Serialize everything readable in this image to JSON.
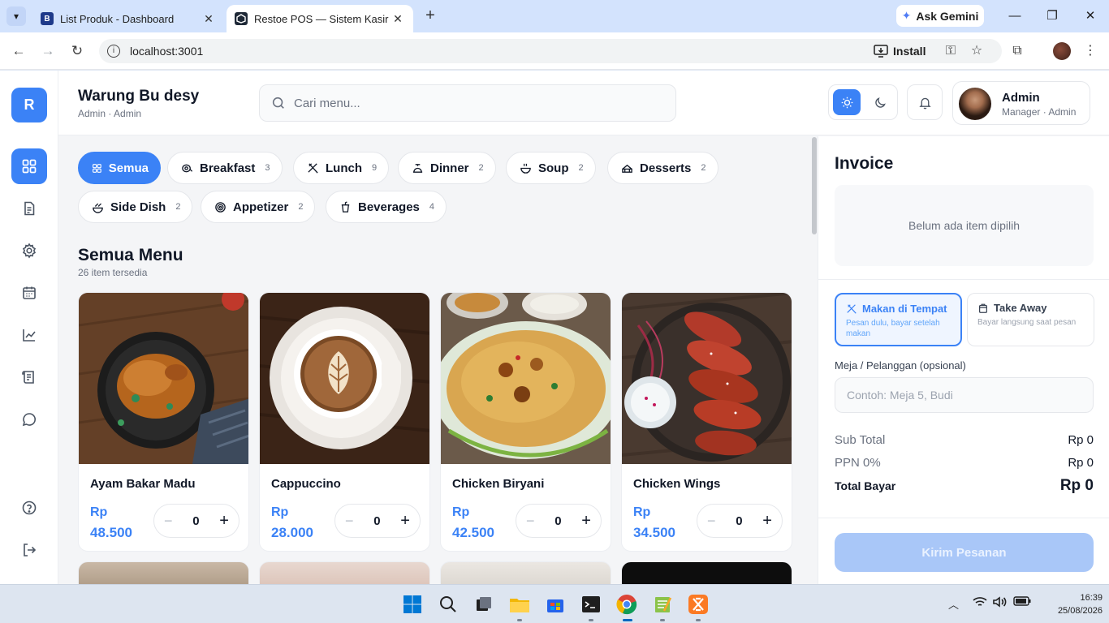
{
  "browser": {
    "tabs": [
      {
        "title": "List Produk - Dashboard",
        "favicon": "B"
      },
      {
        "title": "Restoe POS — Sistem Kasir",
        "favicon": "restoe-icon"
      }
    ],
    "gemini_label": "Ask Gemini",
    "url": "localhost:3001",
    "install_label": "Install"
  },
  "app": {
    "logo_letter": "R",
    "store_name": "Warung Bu desy",
    "store_sub": "Admin · Admin",
    "search_placeholder": "Cari menu...",
    "user": {
      "name": "Admin",
      "role": "Manager · Admin"
    },
    "rail_icons": [
      "grid-icon",
      "document-icon",
      "gear-icon",
      "calendar-icon",
      "chart-icon",
      "receipt-icon",
      "chat-icon",
      "help-icon",
      "logout-icon"
    ]
  },
  "categories": [
    {
      "label": "Semua",
      "count": "",
      "icon": "grid-icon"
    },
    {
      "label": "Breakfast",
      "count": "3",
      "icon": "egg-icon"
    },
    {
      "label": "Lunch",
      "count": "9",
      "icon": "utensils-icon"
    },
    {
      "label": "Dinner",
      "count": "2",
      "icon": "cloche-icon"
    },
    {
      "label": "Soup",
      "count": "2",
      "icon": "bowl-icon"
    },
    {
      "label": "Desserts",
      "count": "2",
      "icon": "cake-icon"
    },
    {
      "label": "Side Dish",
      "count": "2",
      "icon": "dish-icon"
    },
    {
      "label": "Appetizer",
      "count": "2",
      "icon": "spiral-icon"
    },
    {
      "label": "Beverages",
      "count": "4",
      "icon": "cup-icon"
    }
  ],
  "menu": {
    "title": "Semua Menu",
    "subtitle": "26 item tersedia",
    "items": [
      {
        "name": "Ayam Bakar Madu",
        "currency": "Rp",
        "price": "48.500",
        "qty": "0"
      },
      {
        "name": "Cappuccino",
        "currency": "Rp",
        "price": "28.000",
        "qty": "0"
      },
      {
        "name": "Chicken Biryani",
        "currency": "Rp",
        "price": "42.500",
        "qty": "0"
      },
      {
        "name": "Chicken Wings",
        "currency": "Rp",
        "price": "34.500",
        "qty": "0"
      }
    ]
  },
  "invoice": {
    "title": "Invoice",
    "empty_text": "Belum ada item dipilih",
    "order_types": [
      {
        "label": "Makan di Tempat",
        "desc": "Pesan dulu, bayar setelah makan"
      },
      {
        "label": "Take Away",
        "desc": "Bayar langsung saat pesan"
      }
    ],
    "table_label": "Meja / Pelanggan (opsional)",
    "table_placeholder": "Contoh: Meja 5, Budi",
    "subtotal_label": "Sub Total",
    "subtotal_value": "Rp 0",
    "tax_label": "PPN 0%",
    "tax_value": "Rp 0",
    "total_label": "Total Bayar",
    "total_value": "Rp 0",
    "submit_label": "Kirim Pesanan"
  },
  "taskbar": {
    "time": "16:39",
    "date": "25/08/2026"
  },
  "colors": {
    "accent": "#3b82f6",
    "tab_bar": "#d3e3fd"
  }
}
